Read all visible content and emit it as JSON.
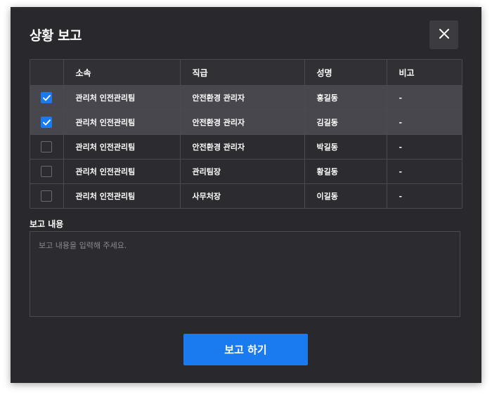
{
  "dialog": {
    "title": "상황 보고",
    "close_icon": "close-icon"
  },
  "table": {
    "columns": [
      "",
      "소속",
      "직급",
      "성명",
      "비고"
    ],
    "rows": [
      {
        "checked": true,
        "department": "관리처 인전관리팀",
        "position": "안전환경 관리자",
        "name": "홍길동",
        "note": "-"
      },
      {
        "checked": true,
        "department": "관리처 인전관리팀",
        "position": "안전환경 관리자",
        "name": "김길동",
        "note": "-"
      },
      {
        "checked": false,
        "department": "관리처 인전관리팀",
        "position": "안전환경 관리자",
        "name": "박길동",
        "note": "-"
      },
      {
        "checked": false,
        "department": "관리처 인전관리팀",
        "position": "관리팀장",
        "name": "황길동",
        "note": "-"
      },
      {
        "checked": false,
        "department": "관리처 인전관리팀",
        "position": "사무처장",
        "name": "이길동",
        "note": "-"
      }
    ]
  },
  "report": {
    "label": "보고 내용",
    "value": "",
    "placeholder": "보고 내용을 입력해 주세요."
  },
  "submit": {
    "label": "보고 하기"
  },
  "colors": {
    "accent": "#1a7bf0",
    "background": "#28282d",
    "selected_row": "#47474d"
  }
}
